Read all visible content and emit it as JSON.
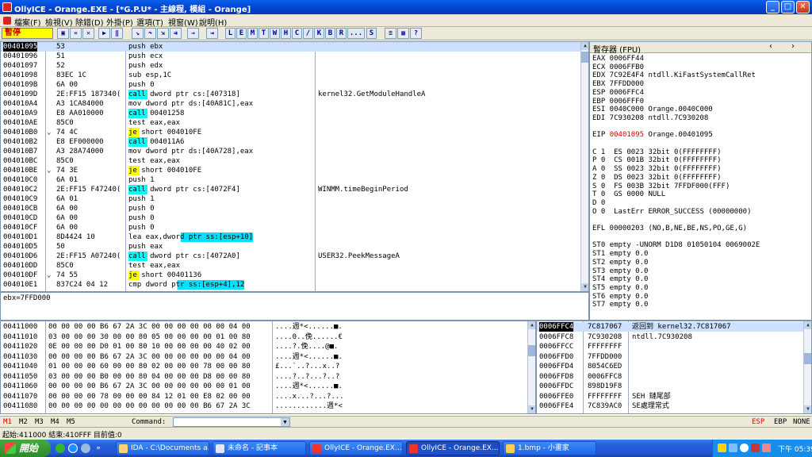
{
  "window": {
    "title": "OllyICE - Orange.EXE - [*G.P.U* - 主線程, 模組 - Orange]",
    "min": "_",
    "max": "□",
    "close": "✕"
  },
  "menu": [
    "檔案(F)",
    "檢視(V)",
    "除錯(D)",
    "外掛(P)",
    "選項(T)",
    "視窗(W)",
    "說明(H)"
  ],
  "toolbar": {
    "status": "暫停",
    "letters": [
      "L",
      "E",
      "M",
      "T",
      "W",
      "H",
      "C",
      "/",
      "K",
      "B",
      "R",
      "...",
      "S"
    ]
  },
  "disasm": [
    {
      "addr": "00401095",
      "hex": "53",
      "asm": "push ebx",
      "cmt": ""
    },
    {
      "addr": "00401096",
      "hex": "51",
      "asm": "push ecx",
      "cmt": ""
    },
    {
      "addr": "00401097",
      "hex": "52",
      "asm": "push edx",
      "cmt": ""
    },
    {
      "addr": "00401098",
      "hex": "83EC 1C",
      "asm": "sub esp,1C",
      "cmt": ""
    },
    {
      "addr": "0040109B",
      "hex": "6A 00",
      "asm": "push 0",
      "cmt": ""
    },
    {
      "addr": "0040109D",
      "hex": "2E:FF15 187340(",
      "asm": "call dword ptr cs:[407318]",
      "cmt": "kernel32.GetModuleHandleA"
    },
    {
      "addr": "004010A4",
      "hex": "A3 1CA84000",
      "asm": "mov dword ptr ds:[40A81C],eax",
      "cmt": ""
    },
    {
      "addr": "004010A9",
      "hex": "E8 AA010000",
      "asm": "call 00401258",
      "cmt": ""
    },
    {
      "addr": "004010AE",
      "hex": "85C0",
      "asm": "test eax,eax",
      "cmt": ""
    },
    {
      "addr": "004010B0",
      "hex": "74 4C",
      "asm": "je short 004010FE",
      "cmt": ""
    },
    {
      "addr": "004010B2",
      "hex": "E8 EF000000",
      "asm": "call 004011A6",
      "cmt": ""
    },
    {
      "addr": "004010B7",
      "hex": "A3 28A74000",
      "asm": "mov dword ptr ds:[40A728],eax",
      "cmt": ""
    },
    {
      "addr": "004010BC",
      "hex": "85C0",
      "asm": "test eax,eax",
      "cmt": ""
    },
    {
      "addr": "004010BE",
      "hex": "74 3E",
      "asm": "je short 004010FE",
      "cmt": ""
    },
    {
      "addr": "004010C0",
      "hex": "6A 01",
      "asm": "push 1",
      "cmt": ""
    },
    {
      "addr": "004010C2",
      "hex": "2E:FF15 F47240(",
      "asm": "call dword ptr cs:[4072F4]",
      "cmt": "WINMM.timeBeginPeriod"
    },
    {
      "addr": "004010C9",
      "hex": "6A 01",
      "asm": "push 1",
      "cmt": ""
    },
    {
      "addr": "004010CB",
      "hex": "6A 00",
      "asm": "push 0",
      "cmt": ""
    },
    {
      "addr": "004010CD",
      "hex": "6A 00",
      "asm": "push 0",
      "cmt": ""
    },
    {
      "addr": "004010CF",
      "hex": "6A 00",
      "asm": "push 0",
      "cmt": ""
    },
    {
      "addr": "004010D1",
      "hex": "8D4424 10",
      "asm": "lea eax,dword ptr ss:[esp+10]",
      "cmt": ""
    },
    {
      "addr": "004010D5",
      "hex": "50",
      "asm": "push eax",
      "cmt": ""
    },
    {
      "addr": "004010D6",
      "hex": "2E:FF15 A07240(",
      "asm": "call dword ptr cs:[4072A0]",
      "cmt": "USER32.PeekMessageA"
    },
    {
      "addr": "004010DD",
      "hex": "85C0",
      "asm": "test eax,eax",
      "cmt": ""
    },
    {
      "addr": "004010DF",
      "hex": "74 55",
      "asm": "je short 00401136",
      "cmt": ""
    },
    {
      "addr": "004010E1",
      "hex": "837C24 04 12",
      "asm": "cmp dword ptr ss:[esp+4],12",
      "cmt": ""
    }
  ],
  "info": "ebx=7FFD000",
  "registers": {
    "title": "暫存器 (FPU)",
    "lines": [
      "EAX 0006FF44",
      "ECX 0006FFB0",
      "EDX 7C92E4F4 ntdll.KiFastSystemCallRet",
      "EBX 7FFDD000",
      "ESP 0006FFC4",
      "EBP 0006FFF0",
      "ESI 0040C000 Orange.0040C000",
      "EDI 7C930208 ntdll.7C930208",
      "",
      "EIP 00401095 Orange.00401095",
      "",
      "C 1  ES 0023 32bit 0(FFFFFFFF)",
      "P 0  CS 001B 32bit 0(FFFFFFFF)",
      "A 0  SS 0023 32bit 0(FFFFFFFF)",
      "Z 0  DS 0023 32bit 0(FFFFFFFF)",
      "S 0  FS 003B 32bit 7FFDF000(FFF)",
      "T 0  GS 0000 NULL",
      "D 0",
      "O 0  LastErr ERROR_SUCCESS (00000000)",
      "",
      "EFL 00000203 (NO,B,NE,BE,NS,PO,GE,G)",
      "",
      "ST0 empty -UNORM D1D8 01050104 0069002E",
      "ST1 empty 0.0",
      "ST2 empty 0.0",
      "ST3 empty 0.0",
      "ST4 empty 0.0",
      "ST5 empty 0.0",
      "ST6 empty 0.0",
      "ST7 empty 0.0"
    ]
  },
  "dump": [
    {
      "addr": "00411000",
      "hex": "00 00 00 00 B6 67 2A 3C 00 00 00 00 00 00 04 00",
      "asc": "....週*<......■."
    },
    {
      "addr": "00411010",
      "hex": "03 00 00 00 30 00 00 80 05 00 00 00 00 01 00 80",
      "asc": "....0..俛......€"
    },
    {
      "addr": "00411020",
      "hex": "0E 00 00 00 D0 01 00 80 10 00 00 00 00 40 02 00",
      "asc": "....?.俛....@■."
    },
    {
      "addr": "00411030",
      "hex": "00 00 00 00 B6 67 2A 3C 00 00 00 00 00 00 04 00",
      "asc": "....週*<......■."
    },
    {
      "addr": "00411040",
      "hex": "01 00 00 00 60 00 00 80 02 00 00 00 78 00 00 80",
      "asc": "£...`..?...x..?"
    },
    {
      "addr": "00411050",
      "hex": "03 00 00 00 B0 00 00 80 04 00 00 00 D8 00 00 80",
      "asc": "....?..?...?..?"
    },
    {
      "addr": "00411060",
      "hex": "00 00 00 00 B6 67 2A 3C 00 00 00 00 00 00 01 00",
      "asc": "....週*<......■."
    },
    {
      "addr": "00411070",
      "hex": "00 00 00 00 78 00 00 00 84 12 01 00 E8 02 00 00",
      "asc": "....x...?...?..."
    },
    {
      "addr": "00411080",
      "hex": "00 00 00 00 00 00 00 00 00 00 00 00 B6 67 2A 3C",
      "asc": "............週*<"
    }
  ],
  "stack": [
    {
      "addr": "0006FFC4",
      "val": "7C817067",
      "cmt": "返回到 kernel32.7C817067"
    },
    {
      "addr": "0006FFC8",
      "val": "7C930208",
      "cmt": "ntdll.7C930208"
    },
    {
      "addr": "0006FFCC",
      "val": "FFFFFFFF",
      "cmt": ""
    },
    {
      "addr": "0006FFD0",
      "val": "7FFDD000",
      "cmt": ""
    },
    {
      "addr": "0006FFD4",
      "val": "8054C6ED",
      "cmt": ""
    },
    {
      "addr": "0006FFD8",
      "val": "0006FFC8",
      "cmt": ""
    },
    {
      "addr": "0006FFDC",
      "val": "898D19F8",
      "cmt": ""
    },
    {
      "addr": "0006FFE0",
      "val": "FFFFFFFF",
      "cmt": "SEH 鏈尾部"
    },
    {
      "addr": "0006FFE4",
      "val": "7C839AC0",
      "cmt": "SE處理常式"
    }
  ],
  "tabs": [
    "M1",
    "M2",
    "M3",
    "M4",
    "M5"
  ],
  "command": {
    "label": "Command:"
  },
  "regflags": [
    "ESP",
    "EBP",
    "NONE"
  ],
  "status": "起始:411000 結束:410FFF 目前值:0",
  "taskbar": {
    "start": "開始",
    "tasks": [
      "IDA - C:\\Documents a...",
      "未命名 - 記事本",
      "OllyICE - Orange.EX...",
      "OllyICE - Orange.EX...",
      "1.bmp - 小畫家"
    ],
    "clock": "下午 05:39"
  },
  "colors": {
    "titlebar": "#0046d5",
    "highlight": "#00ffff",
    "jump": "#ffff00",
    "eip": "#e00000"
  }
}
